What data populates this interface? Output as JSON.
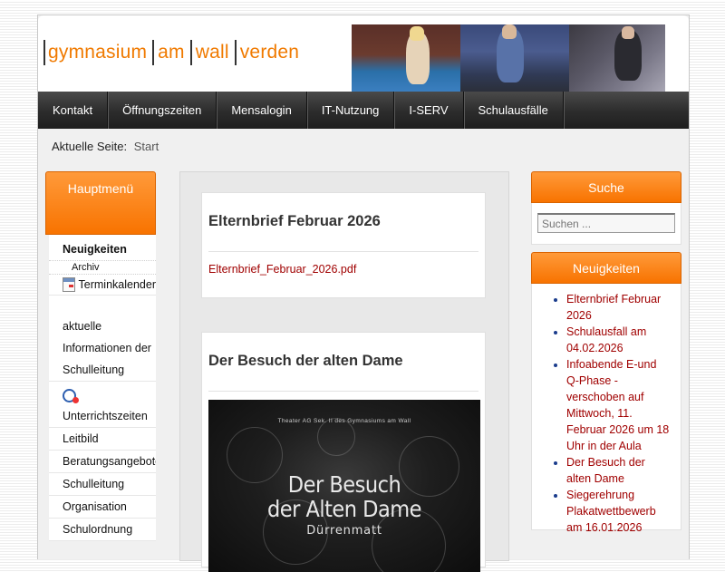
{
  "site": {
    "logo_segments": [
      "gymnasium",
      "am",
      "wall",
      "verden"
    ]
  },
  "nav": {
    "items": [
      "Kontakt",
      "Öffnungszeiten",
      "Mensalogin",
      "IT-Nutzung",
      "I-SERV",
      "Schulausfälle"
    ]
  },
  "breadcrumb": {
    "label": "Aktuelle Seite:",
    "current": "Start"
  },
  "left_menu": {
    "title": "Hauptmenü",
    "items": [
      "Neuigkeiten",
      "Archiv",
      "Terminkalender",
      "aktuelle",
      "Informationen der",
      "Schulleitung",
      "Unterrichtszeiten",
      "Leitbild",
      "Beratungsangebote",
      "Schulleitung",
      "Organisation",
      "Schulordnung"
    ]
  },
  "articles": [
    {
      "title": "Elternbrief Februar 2026",
      "link": "Elternbrief_Februar_2026.pdf"
    },
    {
      "title": "Der Besuch der alten Dame",
      "poster": {
        "top_line": "Theater AG Sek. II des Gymnasiums am Wall",
        "title_line1": "Der Besuch",
        "title_line2": "der Alten Dame",
        "author": "Dürrenmatt"
      }
    }
  ],
  "search": {
    "title": "Suche",
    "placeholder": "Suchen ..."
  },
  "news": {
    "title": "Neuigkeiten",
    "items": [
      "Elternbrief Februar 2026",
      "Schulausfall am 04.02.2026",
      "Infoabende E-und Q-Phase - verschoben auf Mittwoch, 11. Februar 2026 um 18 Uhr in der Aula",
      "Der Besuch der alten Dame",
      "Siegerehrung Plakatwettbewerb am 16.01.2026"
    ]
  },
  "colors": {
    "accent": "#f87300",
    "link": "#a00000",
    "nav_bg": "#2c2c2c"
  },
  "icons": {
    "calendar": "calendar-icon",
    "clock": "clock-icon"
  }
}
